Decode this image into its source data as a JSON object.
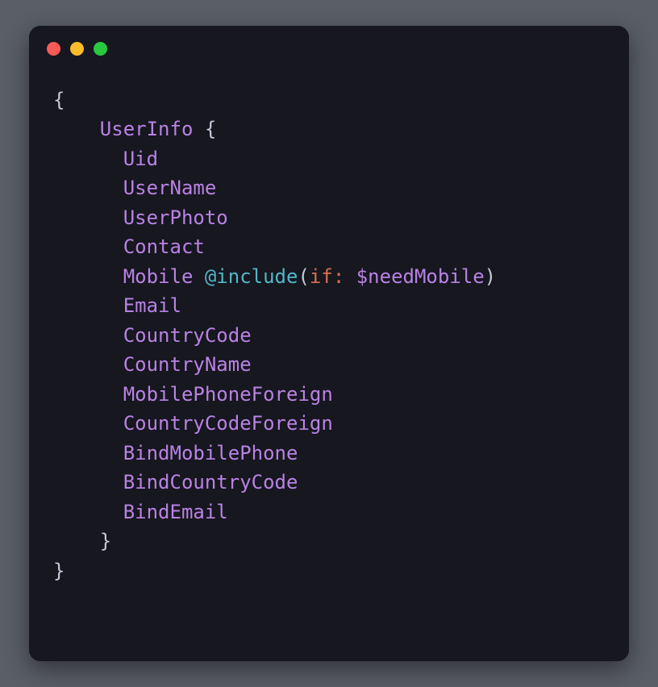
{
  "code": {
    "root": "UserInfo",
    "fields": [
      "Uid",
      "UserName",
      "UserPhoto",
      "Contact",
      "Mobile",
      "Email",
      "CountryCode",
      "CountryName",
      "MobilePhoneForeign",
      "CountryCodeForeign",
      "BindMobilePhone",
      "BindCountryCode",
      "BindEmail"
    ],
    "directive": {
      "name": "@include",
      "arg": "if",
      "var": "$needMobile"
    },
    "punct": {
      "lbrace": "{",
      "rbrace": "}",
      "lparen": "(",
      "rparen": ")",
      "colon": ":",
      "space": " "
    }
  }
}
